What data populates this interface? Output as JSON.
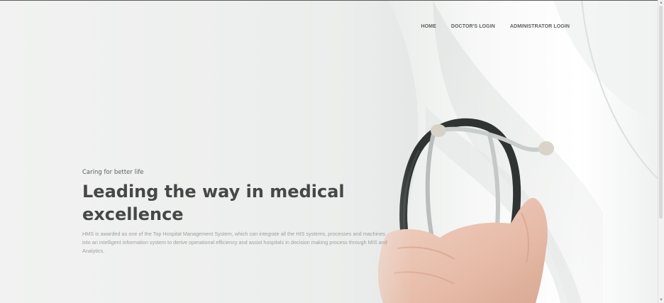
{
  "nav": {
    "items": [
      {
        "label": "HOME"
      },
      {
        "label": "DOCTOR'S LOGIN"
      },
      {
        "label": "ADMINISTRATOR LOGIN"
      }
    ]
  },
  "hero": {
    "tagline": "Caring for better life",
    "headline": "Leading the way in medical excellence",
    "description": "HMS is awarded as one of the Top Hospital Management System, which can integrate all the HIS systems, processes and machines into an intelligent information system to derive operational efficiency and assist hospitals in decision making process through MIS and Analytics."
  },
  "colors": {
    "background": "#eef0ef",
    "headline": "#454846",
    "nav_text": "#5d5f5f",
    "description": "#9da09e"
  }
}
